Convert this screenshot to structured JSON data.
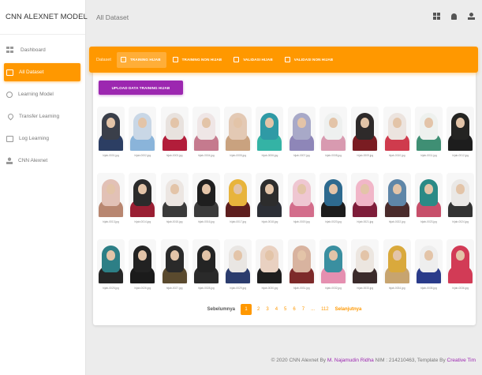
{
  "brand": "CNN ALEXNET MODEL",
  "sidebar": {
    "items": [
      {
        "label": "Dashboard",
        "icon": "dashboard-icon",
        "active": false
      },
      {
        "label": "All Dataset",
        "icon": "folder-icon",
        "active": true
      },
      {
        "label": "Learning Model",
        "icon": "learning-icon",
        "active": false
      },
      {
        "label": "Transfer Learning",
        "icon": "pin-icon",
        "active": false
      },
      {
        "label": "Log Learning",
        "icon": "book-icon",
        "active": false
      },
      {
        "label": "CNN Alexnet",
        "icon": "person-icon",
        "active": false
      }
    ]
  },
  "topbar": {
    "title": "All Dataset",
    "icons": [
      "grid-icon",
      "bell-icon",
      "user-icon"
    ]
  },
  "tabbar": {
    "caption": "Dataset",
    "tabs": [
      {
        "label": "TRAINING HIJAB",
        "active": true
      },
      {
        "label": "TRAINING NON HIJAB",
        "active": false
      },
      {
        "label": "VALIDASI HIJAB",
        "active": false
      },
      {
        "label": "VALIDASI NON HIJAB",
        "active": false
      }
    ]
  },
  "upload_label": "UPLOAD DATA TRAINING HIJAB",
  "images": [
    {
      "caption": "hijab-0001.jpg",
      "hijab": "#3a3f4a",
      "body": "#2c3e63"
    },
    {
      "caption": "hijab-0002.jpg",
      "hijab": "#c9d7e6",
      "body": "#8ab4da"
    },
    {
      "caption": "hijab-0003.jpg",
      "hijab": "#e8e2de",
      "body": "#b21d3a"
    },
    {
      "caption": "hijab-0004.jpg",
      "hijab": "#efe6e6",
      "body": "#c57a8e"
    },
    {
      "caption": "hijab-0005.jpg",
      "hijab": "#e3c9b4",
      "body": "#c9a27f"
    },
    {
      "caption": "hijab-0006.jpg",
      "hijab": "#2f9aa5",
      "body": "#34b3a5"
    },
    {
      "caption": "hijab-0007.jpg",
      "hijab": "#a8a9c8",
      "body": "#8e86b8"
    },
    {
      "caption": "hijab-0008.jpg",
      "hijab": "#eef0ef",
      "body": "#d89ab0"
    },
    {
      "caption": "hijab-0009.jpg",
      "hijab": "#2e2a2a",
      "body": "#7a1c22"
    },
    {
      "caption": "hijab-0010.jpg",
      "hijab": "#ece4df",
      "body": "#cf3b4d"
    },
    {
      "caption": "hijab-0011.jpg",
      "hijab": "#eef1ee",
      "body": "#3f8f74"
    },
    {
      "caption": "hijab-0012.jpg",
      "hijab": "#242422",
      "body": "#1d1d1d"
    },
    {
      "caption": "hijab-0013.jpg",
      "hijab": "#e2c1b6",
      "body": "#b88670"
    },
    {
      "caption": "hijab-0014.jpg",
      "hijab": "#2b2b2b",
      "body": "#9a1f33"
    },
    {
      "caption": "hijab-0015.jpg",
      "hijab": "#ece6e2",
      "body": "#3a3a3a"
    },
    {
      "caption": "hijab-0016.jpg",
      "hijab": "#1f1f1f",
      "body": "#3b3b3b"
    },
    {
      "caption": "hijab-0017.jpg",
      "hijab": "#e8b43c",
      "body": "#5d1e1e"
    },
    {
      "caption": "hijab-0018.jpg",
      "hijab": "#2d2d2d",
      "body": "#2c2f36"
    },
    {
      "caption": "hijab-0019.jpg",
      "hijab": "#efc7d2",
      "body": "#d36d8b"
    },
    {
      "caption": "hijab-0020.jpg",
      "hijab": "#2d6a8f",
      "body": "#1c1c1c"
    },
    {
      "caption": "hijab-0021.jpg",
      "hijab": "#f1b6c8",
      "body": "#7e1d3a"
    },
    {
      "caption": "hijab-0022.jpg",
      "hijab": "#5e86a8",
      "body": "#4a2b2b"
    },
    {
      "caption": "hijab-0023.jpg",
      "hijab": "#2b8a86",
      "body": "#c74f6a"
    },
    {
      "caption": "hijab-0024.jpg",
      "hijab": "#eae8e6",
      "body": "#333333"
    },
    {
      "caption": "hijab-0025.jpg",
      "hijab": "#2d7f86",
      "body": "#262626"
    },
    {
      "caption": "hijab-0026.jpg",
      "hijab": "#222222",
      "body": "#1b1b1b"
    },
    {
      "caption": "hijab-0027.jpg",
      "hijab": "#2a2a2a",
      "body": "#5a4a2e"
    },
    {
      "caption": "hijab-0028.jpg",
      "hijab": "#242424",
      "body": "#2a2a2a"
    },
    {
      "caption": "hijab-0029.jpg",
      "hijab": "#e9e6e3",
      "body": "#2b3c6d"
    },
    {
      "caption": "hijab-0030.jpg",
      "hijab": "#e9d1c1",
      "body": "#1e1e1e"
    },
    {
      "caption": "hijab-0031.jpg",
      "hijab": "#d8b39f",
      "body": "#7d2a2a"
    },
    {
      "caption": "hijab-0032.jpg",
      "hijab": "#3a8fa0",
      "body": "#e58fb0"
    },
    {
      "caption": "hijab-0033.jpg",
      "hijab": "#ece6e0",
      "body": "#3b2b2b"
    },
    {
      "caption": "hijab-0034.jpg",
      "hijab": "#d9a93c",
      "body": "#c7a46f"
    },
    {
      "caption": "hijab-0035.jpg",
      "hijab": "#eeeeee",
      "body": "#2a3b8a"
    },
    {
      "caption": "hijab-0036.jpg",
      "hijab": "#d23b56",
      "body": "#d23b56"
    }
  ],
  "pagination": {
    "prev": "Sebelumnya",
    "pages": [
      "1",
      "2",
      "3",
      "4",
      "5",
      "6",
      "7",
      "...",
      "112"
    ],
    "current": "1",
    "next": "Selanjutnya"
  },
  "footer": {
    "prefix": "© 2020 CNN Alexnet By ",
    "author": "M. Najamudin Ridha",
    "middle": " NIM : 214210463, Template By ",
    "template": "Creative Tim"
  }
}
